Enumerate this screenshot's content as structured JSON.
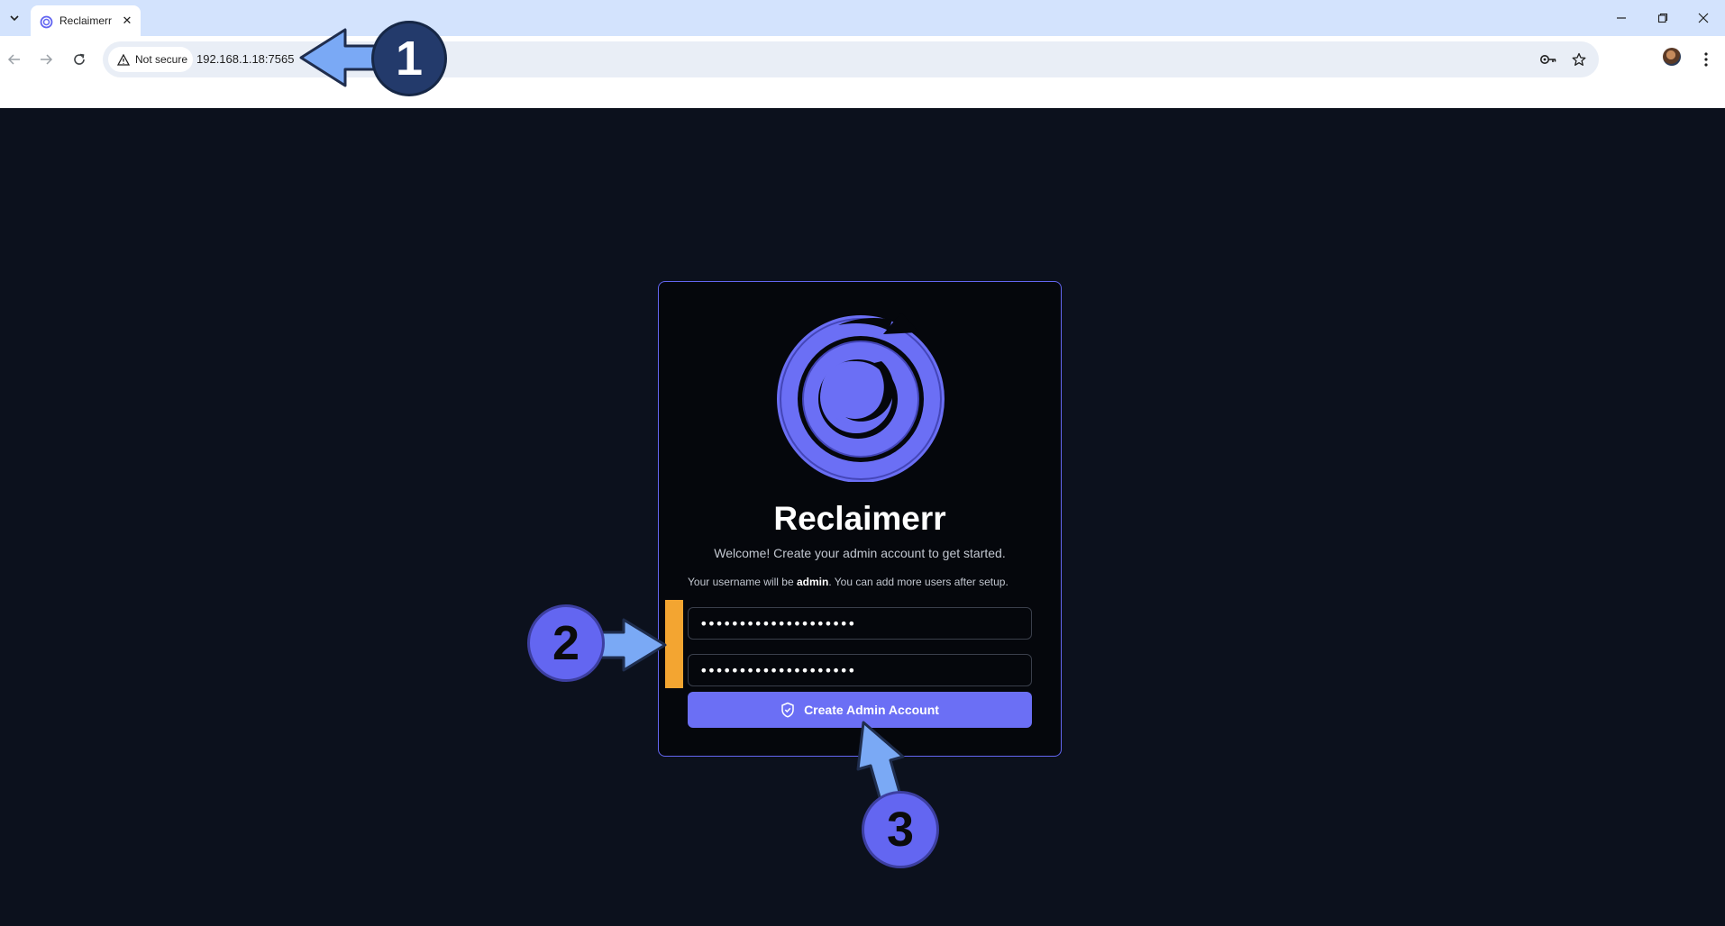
{
  "browser": {
    "tab": {
      "title": "Reclaimerr"
    },
    "address": {
      "security_label": "Not secure",
      "url": "192.168.1.18:7565"
    },
    "icons": {
      "tab_list": "chevron-down-icon",
      "close_tab": "close-icon",
      "back": "arrow-left-icon",
      "forward": "arrow-right-icon",
      "reload": "reload-icon",
      "warning": "warning-icon",
      "password_key": "key-icon",
      "bookmark": "star-icon",
      "menu": "kebab-menu-icon"
    }
  },
  "setup": {
    "app_name": "Reclaimerr",
    "welcome": "Welcome! Create your admin account to get started.",
    "hint_prefix": "Your username will be ",
    "hint_username": "admin",
    "hint_suffix": ". You can add more users after setup.",
    "password_masked": "••••••••••••••••••••",
    "confirm_masked": "••••••••••••••••••••",
    "create_button": "Create Admin Account"
  },
  "annotations": {
    "step1": "1",
    "step2": "2",
    "step3": "3"
  },
  "colors": {
    "accent": "#6366f1",
    "button": "#6b6ff5",
    "highlight": "#f3a531",
    "page_bg": "#0c111d",
    "card_bg": "#05070c",
    "arrow": "#7aa9f5"
  }
}
